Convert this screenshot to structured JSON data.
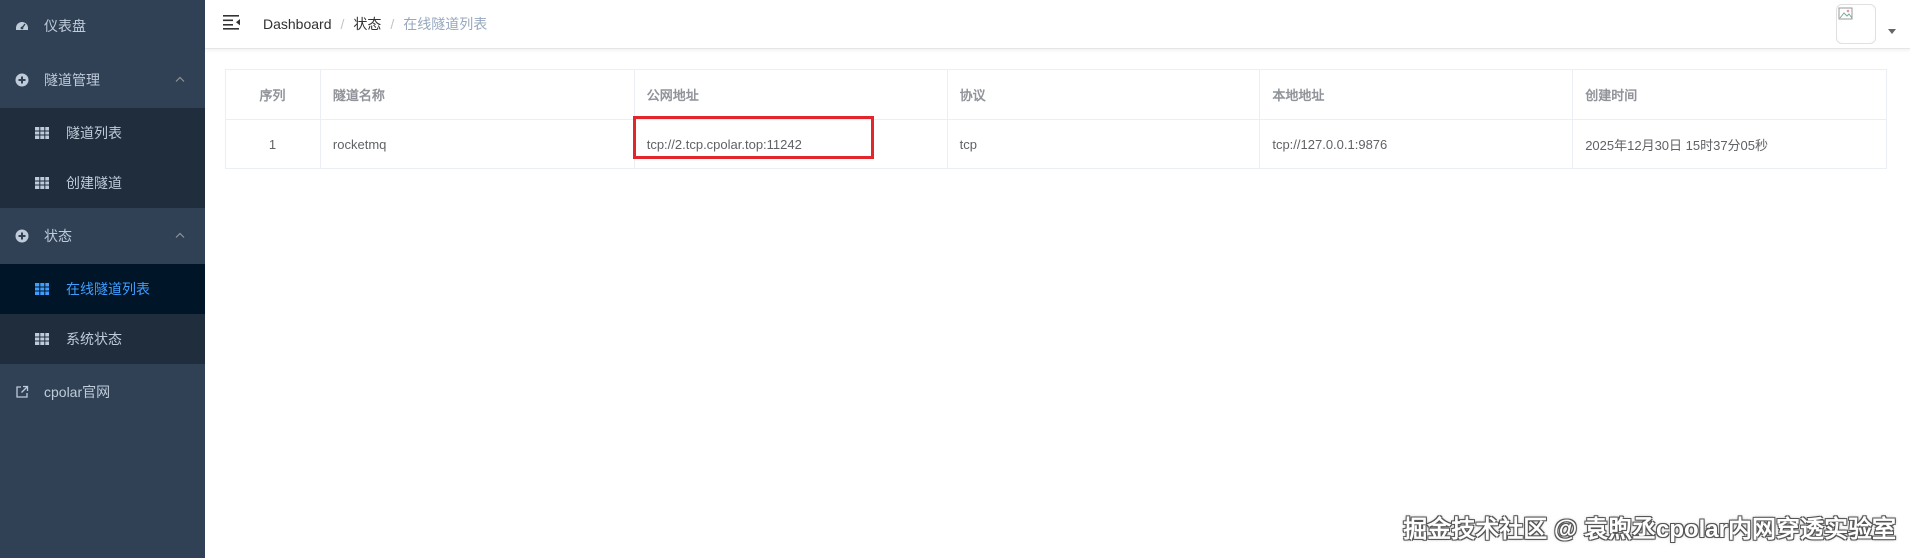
{
  "sidebar": {
    "items": [
      {
        "label": "仪表盘",
        "icon": "dashboard-icon"
      },
      {
        "label": "隧道管理",
        "icon": "plus-circle-icon",
        "expanded": true,
        "children": [
          {
            "label": "隧道列表"
          },
          {
            "label": "创建隧道"
          }
        ]
      },
      {
        "label": "状态",
        "icon": "plus-circle-icon",
        "expanded": true,
        "children": [
          {
            "label": "在线隧道列表",
            "active": true
          },
          {
            "label": "系统状态"
          }
        ]
      },
      {
        "label": "cpolar官网",
        "icon": "external-link-icon"
      }
    ],
    "colors": {
      "background": "#304156",
      "submenu_bg": "#1f2d3d",
      "active_bg": "#001528",
      "active_text": "#409eff",
      "text": "#bfcbd9"
    }
  },
  "breadcrumb": {
    "items": [
      "Dashboard",
      "状态",
      "在线隧道列表"
    ],
    "separator": "/"
  },
  "table": {
    "headers": [
      "序列",
      "隧道名称",
      "公网地址",
      "协议",
      "本地地址",
      "创建时间"
    ],
    "rows": [
      [
        "1",
        "rocketmq",
        "tcp://2.tcp.cpolar.top:11242",
        "tcp",
        "tcp://127.0.0.1:9876",
        "2025年12月30日 15时37分05秒"
      ]
    ]
  },
  "highlight_color": "#e3262b",
  "watermark": "掘金技术社区 @ 袁煦丞cpolar内网穿透实验室"
}
